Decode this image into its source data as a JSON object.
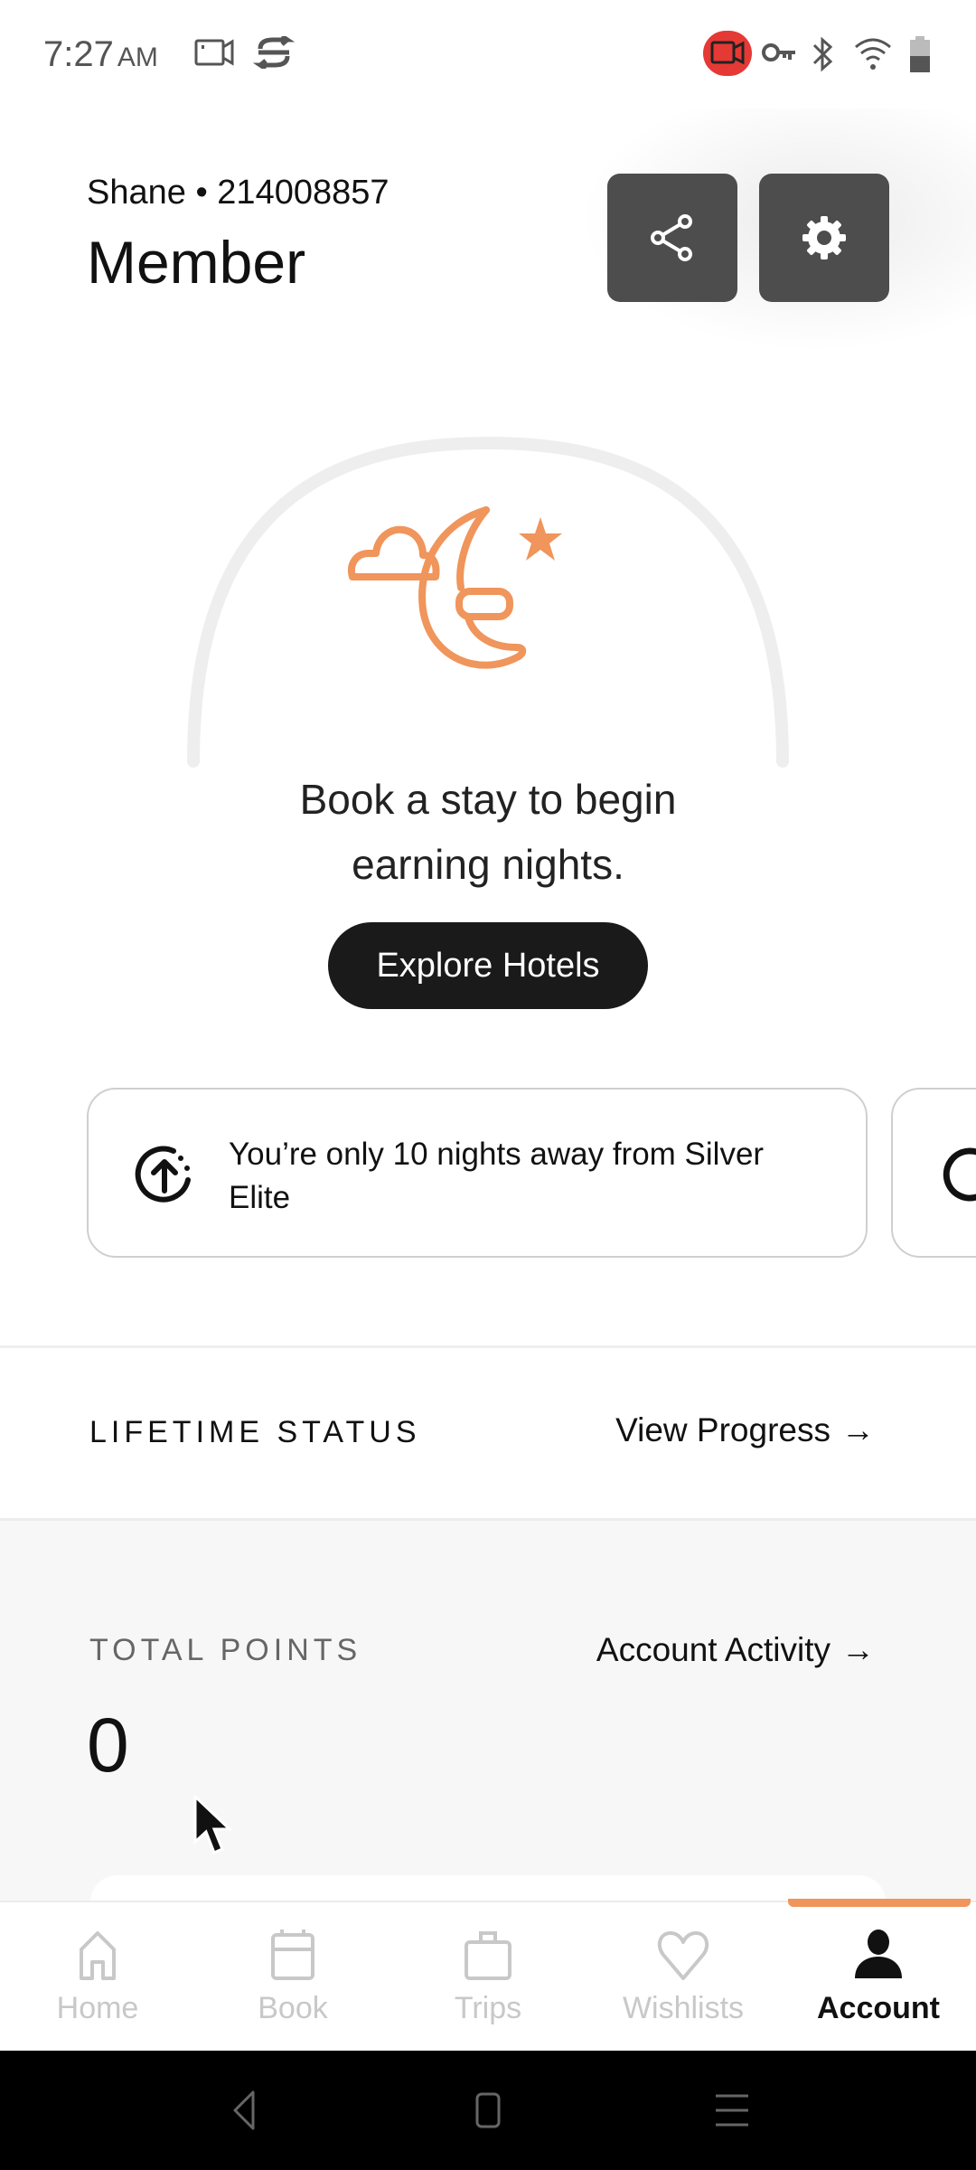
{
  "status_bar": {
    "time": "7:27",
    "ampm": "AM",
    "icons": [
      "video-camera-icon",
      "sync-icon",
      "screen-record-icon",
      "vpn-key-icon",
      "bluetooth-icon",
      "wifi-icon",
      "battery-icon"
    ],
    "record_color": "#e53935"
  },
  "header": {
    "member_line": "Shane • 214008857",
    "tier": "Member",
    "share_icon": "share-icon",
    "settings_icon": "gear-icon"
  },
  "progress": {
    "illustration": "moon-cloud-star-icon",
    "accent_color": "#f0955b",
    "nights_progress_fraction": 0,
    "message_line1": "Book a stay to begin",
    "message_line2": "earning nights.",
    "cta_label": "Explore Hotels"
  },
  "tips": [
    {
      "icon": "upgrade-arrow-icon",
      "text": "You’re only 10 nights away from Silver Elite"
    },
    {
      "icon": "refresh-icon",
      "text": ""
    }
  ],
  "lifetime": {
    "label": "LIFETIME STATUS",
    "link": "View Progress",
    "arrow": "→"
  },
  "points": {
    "label": "TOTAL POINTS",
    "link": "Account Activity",
    "arrow": "→",
    "value": "0"
  },
  "bottom_nav": {
    "items": [
      {
        "label": "Home",
        "icon": "home-icon",
        "active": false
      },
      {
        "label": "Book",
        "icon": "calendar-icon",
        "active": false
      },
      {
        "label": "Trips",
        "icon": "suitcase-icon",
        "active": false
      },
      {
        "label": "Wishlists",
        "icon": "heart-icon",
        "active": false
      },
      {
        "label": "Account",
        "icon": "person-icon",
        "active": true
      }
    ]
  },
  "system_nav": {
    "buttons": [
      "back-icon",
      "home-square-icon",
      "recents-icon"
    ]
  }
}
